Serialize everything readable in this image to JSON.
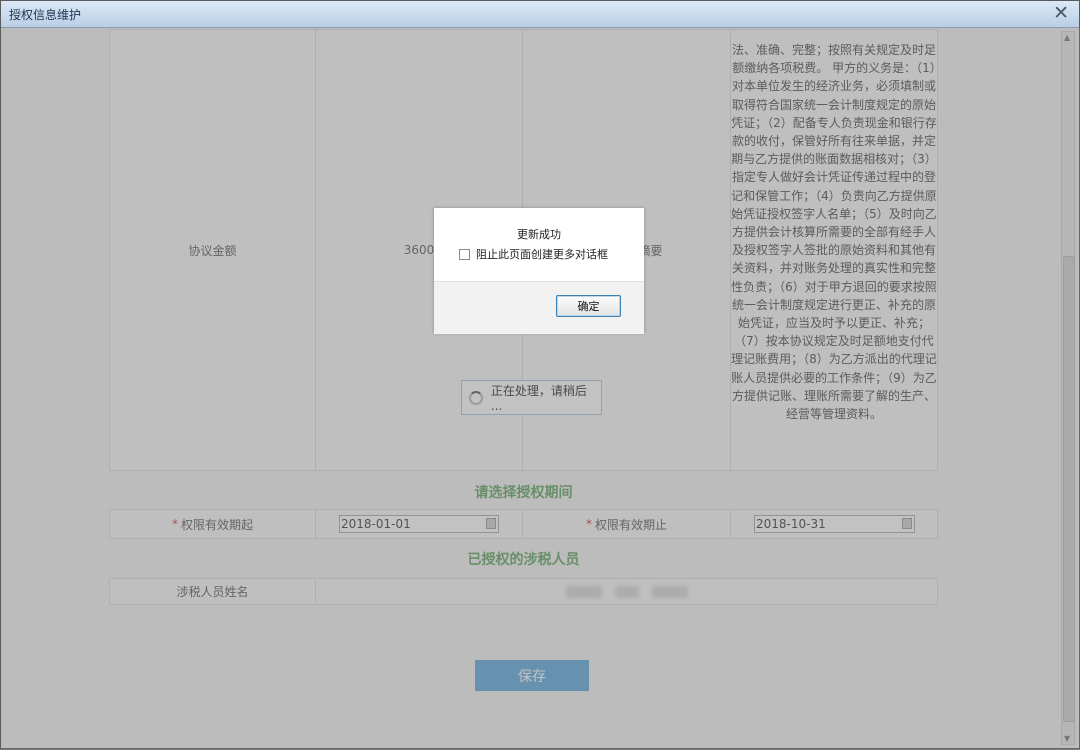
{
  "window": {
    "title": "授权信息维护",
    "close_glyph": "✕"
  },
  "agreement_row": {
    "label": "协议金额",
    "amount": "3600",
    "summary_label": "服务协议摘要",
    "summary_text": "法、准确、完整；按照有关规定及时足额缴纳各项税费。 甲方的义务是：（1）对本单位发生的经济业务，必须填制或取得符合国家统一会计制度规定的原始凭证；（2）配备专人负责现金和银行存款的收付，保管好所有往来单据，并定期与乙方提供的账面数据相核对；（3）指定专人做好会计凭证传递过程中的登记和保管工作；（4）负责向乙方提供原始凭证授权签字人名单；（5）及时向乙方提供会计核算所需要的全部有经手人及授权签字人签批的原始资料和其他有关资料，并对账务处理的真实性和完整性负责；（6）对于甲方退回的要求按照统一会计制度规定进行更正、补充的原始凭证，应当及时予以更正、补充；（7）按本协议规定及时足额地支付代理记账费用；（8）为乙方派出的代理记账人员提供必要的工作条件；（9）为乙方提供记账、理账所需要了解的生产、经营等管理资料。"
  },
  "period_section": {
    "title": "请选择授权期间",
    "start_label": "权限有效期起",
    "start_value": "2018-01-01",
    "end_label": "权限有效期止",
    "end_value": "2018-10-31",
    "required_mark": "*"
  },
  "personnel_section": {
    "title": "已授权的涉税人员",
    "name_label": "涉税人员姓名"
  },
  "save_label": "保存",
  "loading_text": "正在处理，请稍后 ...",
  "dialog": {
    "message": "更新成功",
    "checkbox_label": "阻止此页面创建更多对话框",
    "ok_label": "确定"
  }
}
